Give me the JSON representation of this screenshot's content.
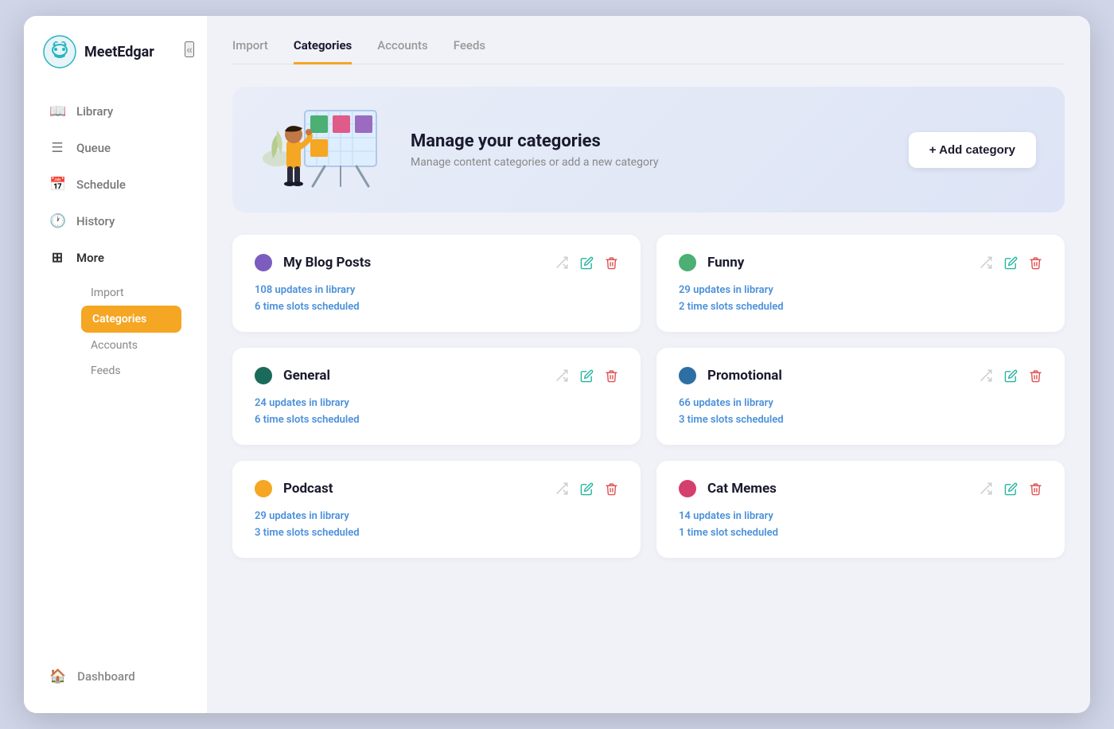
{
  "app": {
    "name": "MeetEdgar"
  },
  "sidebar": {
    "collapse_label": "«",
    "nav_items": [
      {
        "id": "library",
        "label": "Library",
        "icon": "📖"
      },
      {
        "id": "queue",
        "label": "Queue",
        "icon": "☰"
      },
      {
        "id": "schedule",
        "label": "Schedule",
        "icon": "📅"
      },
      {
        "id": "history",
        "label": "History",
        "icon": "🕐"
      },
      {
        "id": "more",
        "label": "More",
        "icon": "⊞"
      }
    ],
    "submenu": [
      {
        "id": "import",
        "label": "Import",
        "active": false
      },
      {
        "id": "categories",
        "label": "Categories",
        "active": true
      },
      {
        "id": "accounts",
        "label": "Accounts",
        "active": false
      },
      {
        "id": "feeds",
        "label": "Feeds",
        "active": false
      }
    ],
    "dashboard": {
      "label": "Dashboard",
      "icon": "🏠"
    }
  },
  "tabs": [
    {
      "id": "import",
      "label": "Import",
      "active": false
    },
    {
      "id": "categories",
      "label": "Categories",
      "active": true
    },
    {
      "id": "accounts",
      "label": "Accounts",
      "active": false
    },
    {
      "id": "feeds",
      "label": "Feeds",
      "active": false
    }
  ],
  "banner": {
    "title": "Manage your categories",
    "subtitle": "Manage content categories or add a new category",
    "add_button_label": "+ Add category"
  },
  "categories": [
    {
      "id": "my-blog-posts",
      "name": "My Blog Posts",
      "color": "#7c5cbf",
      "updates": "108 updates in library",
      "time_slots": "6 time slots scheduled"
    },
    {
      "id": "funny",
      "name": "Funny",
      "color": "#4caf73",
      "updates": "29 updates in library",
      "time_slots": "2 time slots scheduled"
    },
    {
      "id": "general",
      "name": "General",
      "color": "#1a6b5a",
      "updates": "24 updates in library",
      "time_slots": "6 time slots scheduled"
    },
    {
      "id": "promotional",
      "name": "Promotional",
      "color": "#2e6fa3",
      "updates": "66 updates in library",
      "time_slots": "3 time slots scheduled"
    },
    {
      "id": "podcast",
      "name": "Podcast",
      "color": "#f5a623",
      "updates": "29 updates in library",
      "time_slots": "3 time slots scheduled"
    },
    {
      "id": "cat-memes",
      "name": "Cat Memes",
      "color": "#d43f6e",
      "updates": "14 updates in library",
      "time_slots": "1 time slot scheduled"
    }
  ]
}
